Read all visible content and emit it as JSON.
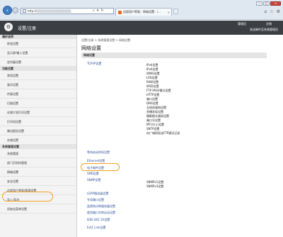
{
  "browser": {
    "url_prefix": "http://",
    "url_masked": "▓▓▓▓▓▓▓▓▓▓▓▓▓▓▓▓",
    "search_icon": "search-icon",
    "refresh_icon": "refresh-icon",
    "tab_title": "远程用户界面：网络设置：i...",
    "tab_close": "×",
    "window_min": "–",
    "window_max": "□",
    "window_close": "×"
  },
  "header": {
    "title": "设置/注册",
    "manager": "管理员",
    "logout": "注销",
    "mail_to": "发送邮件至系统管理员"
  },
  "sidebar": {
    "sections": [
      {
        "title": "偏好选择",
        "items": [
          "纸张设置",
          "显示屏/输入设置",
          "定时器设置"
        ]
      },
      {
        "title": "功能设置",
        "items": [
          "常用设置",
          "复印设置",
          "传真设置",
          "扫描设置",
          "存储介质打印设置",
          "打印机设置",
          "输出报告设置",
          "存储设置"
        ]
      },
      {
        "title": "系统管理设置",
        "items": [
          "系统管理",
          "部门识别码管理",
          "网络设置",
          "安全设置",
          "远程用户界面/管理设置",
          "导入/导出",
          "初始化菜单设置"
        ]
      }
    ]
  },
  "main": {
    "breadcrumb": "设置/注册 > 系统管理设置 > 网络设置",
    "title": "网络设置",
    "section": "网络设置",
    "tcpip": "TCP/IP设置",
    "tcpip_items": [
      "IPv4设置",
      "IPv6设置",
      "WINS设置",
      "LPD设置",
      "RAW设置",
      "WSD设置",
      "FTP PASV模式设置",
      "HTTP设置",
      "端口设置",
      "DNS设置",
      "无线局域网设置",
      "多播发现设置",
      "睡眠模式通知设置",
      "端口号设置",
      "MTU大小设置",
      "SNTP设置",
      "向广域网发送FTP通讯记录"
    ],
    "links_mid": [
      "等待启动时间设置",
      "Ethernet设置",
      "电子邮件设置",
      "SMB设置",
      "SNMP设置"
    ],
    "snmp_items": [
      "SNMPv1设置",
      "SNMPv3设置"
    ],
    "links_bottom": [
      "LDAP服务器设置",
      "专用端口设置",
      "监视和诊断服务器设置",
      "使用端口号转自动设置",
      "IEEE 802.1X设置",
      "Ext1 Link设置"
    ]
  }
}
